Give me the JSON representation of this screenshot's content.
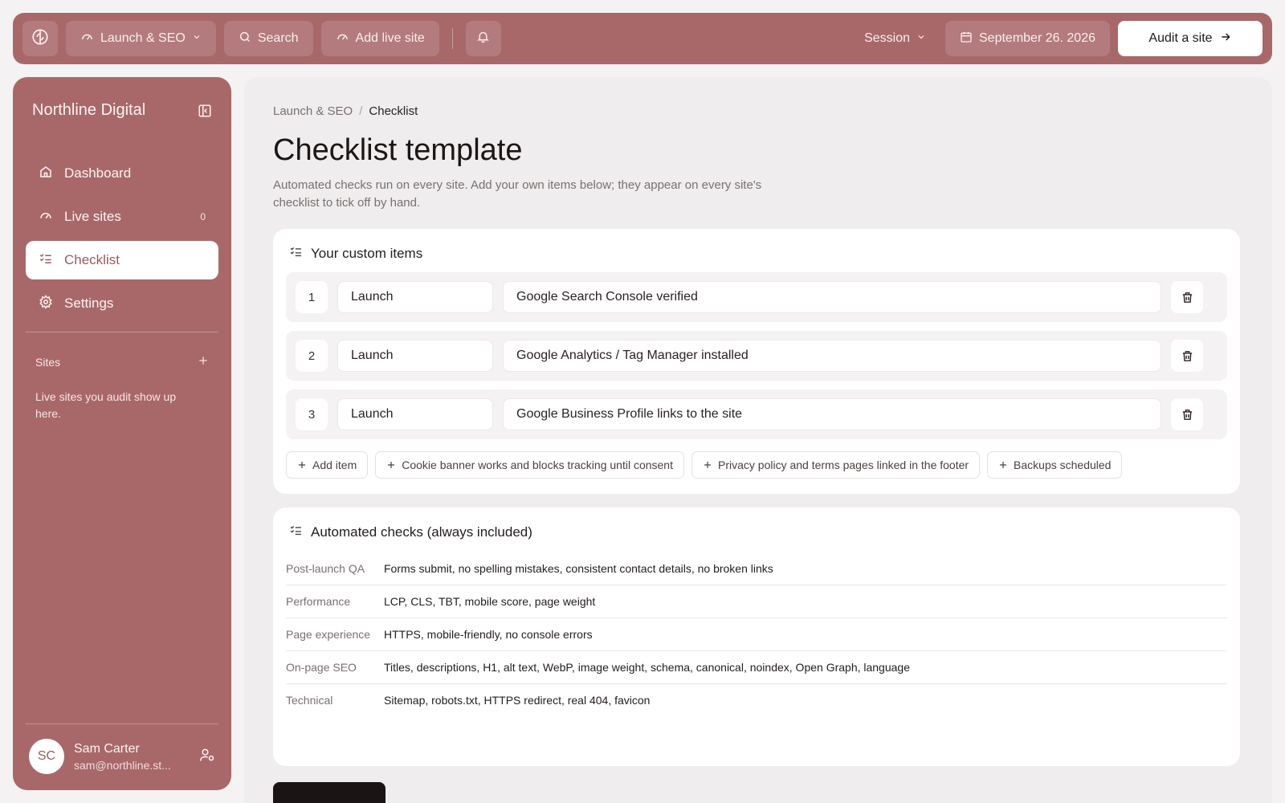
{
  "colors": {
    "accent": "#a8686a",
    "accent_text": "#9a5a5c",
    "content_bg": "#efeded",
    "card_bg": "#ffffff"
  },
  "topbar": {
    "logo_icon": "logo-icon",
    "project_label": "Launch & SEO",
    "search_label": "Search",
    "add_site_label": "Add live site",
    "bell_icon": "bell-icon",
    "session_label": "Session",
    "date_label": "September 26. 2026",
    "audit_label": "Audit a site"
  },
  "sidebar": {
    "brand": "Northline Digital",
    "items": [
      {
        "label": "Dashboard",
        "icon": "home-icon",
        "count": ""
      },
      {
        "label": "Live sites",
        "icon": "gauge-icon",
        "count": "0"
      },
      {
        "label": "Checklist",
        "icon": "checklist-icon",
        "count": "",
        "active": true
      },
      {
        "label": "Settings",
        "icon": "gear-icon",
        "count": ""
      }
    ],
    "sites_header": "Sites",
    "sites_empty": "Live sites you audit show up here.",
    "user": {
      "initials": "SC",
      "name": "Sam Carter",
      "email": "sam@northline.st..."
    }
  },
  "main": {
    "breadcrumb": {
      "parent": "Launch & SEO",
      "separator": "/",
      "current": "Checklist"
    },
    "title": "Checklist template",
    "description": "Automated checks run on every site. Add your own items below; they appear on every site's checklist to tick off by hand.",
    "custom": {
      "header": "Your custom items",
      "items": [
        {
          "num": "1",
          "category": "Launch",
          "text": "Google Search Console verified"
        },
        {
          "num": "2",
          "category": "Launch",
          "text": "Google Analytics / Tag Manager installed"
        },
        {
          "num": "3",
          "category": "Launch",
          "text": "Google Business Profile links to the site"
        }
      ],
      "chips": [
        "Add item",
        "Cookie banner works and blocks tracking until consent",
        "Privacy policy and terms pages linked in the footer",
        "Backups scheduled"
      ]
    },
    "automated": {
      "header": "Automated checks (always included)",
      "rows": [
        {
          "label": "Post-launch QA",
          "value": "Forms submit, no spelling mistakes, consistent contact details, no broken links"
        },
        {
          "label": "Performance",
          "value": "LCP, CLS, TBT, mobile score, page weight"
        },
        {
          "label": "Page experience",
          "value": "HTTPS, mobile-friendly, no console errors"
        },
        {
          "label": "On-page SEO",
          "value": "Titles, descriptions, H1, alt text, WebP, image weight, schema, canonical, noindex, Open Graph, language"
        },
        {
          "label": "Technical",
          "value": "Sitemap, robots.txt, HTTPS redirect, real 404, favicon"
        }
      ]
    }
  }
}
